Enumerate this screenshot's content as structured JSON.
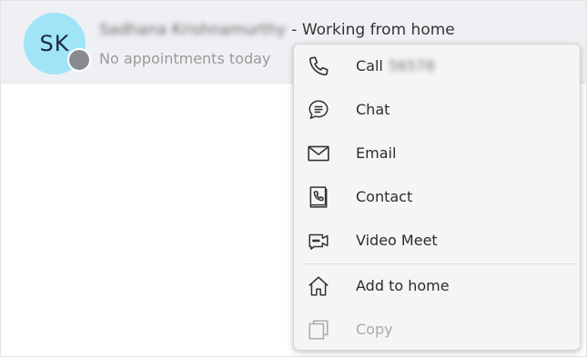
{
  "contact": {
    "initials": "SK",
    "name": "Sadhana Krishnamurthy",
    "status_text": "- Working from home",
    "subtitle": "No appointments today"
  },
  "menu": {
    "items": [
      {
        "label": "Call",
        "extra": "56578",
        "icon": "phone-icon",
        "enabled": true
      },
      {
        "label": "Chat",
        "icon": "chat-icon",
        "enabled": true
      },
      {
        "label": "Email",
        "icon": "envelope-icon",
        "enabled": true
      },
      {
        "label": "Contact",
        "icon": "contact-book-icon",
        "enabled": true
      },
      {
        "label": "Video Meet",
        "icon": "video-camera-icon",
        "enabled": true
      },
      {
        "label": "Add to home",
        "icon": "home-icon",
        "enabled": true
      },
      {
        "label": "Copy",
        "icon": "copy-icon",
        "enabled": false
      }
    ]
  },
  "colors": {
    "avatar_bg": "#9fe4f7",
    "presence_offline": "#888a8e",
    "header_bg": "#eef0f3",
    "menu_bg": "#f5f5f5"
  }
}
